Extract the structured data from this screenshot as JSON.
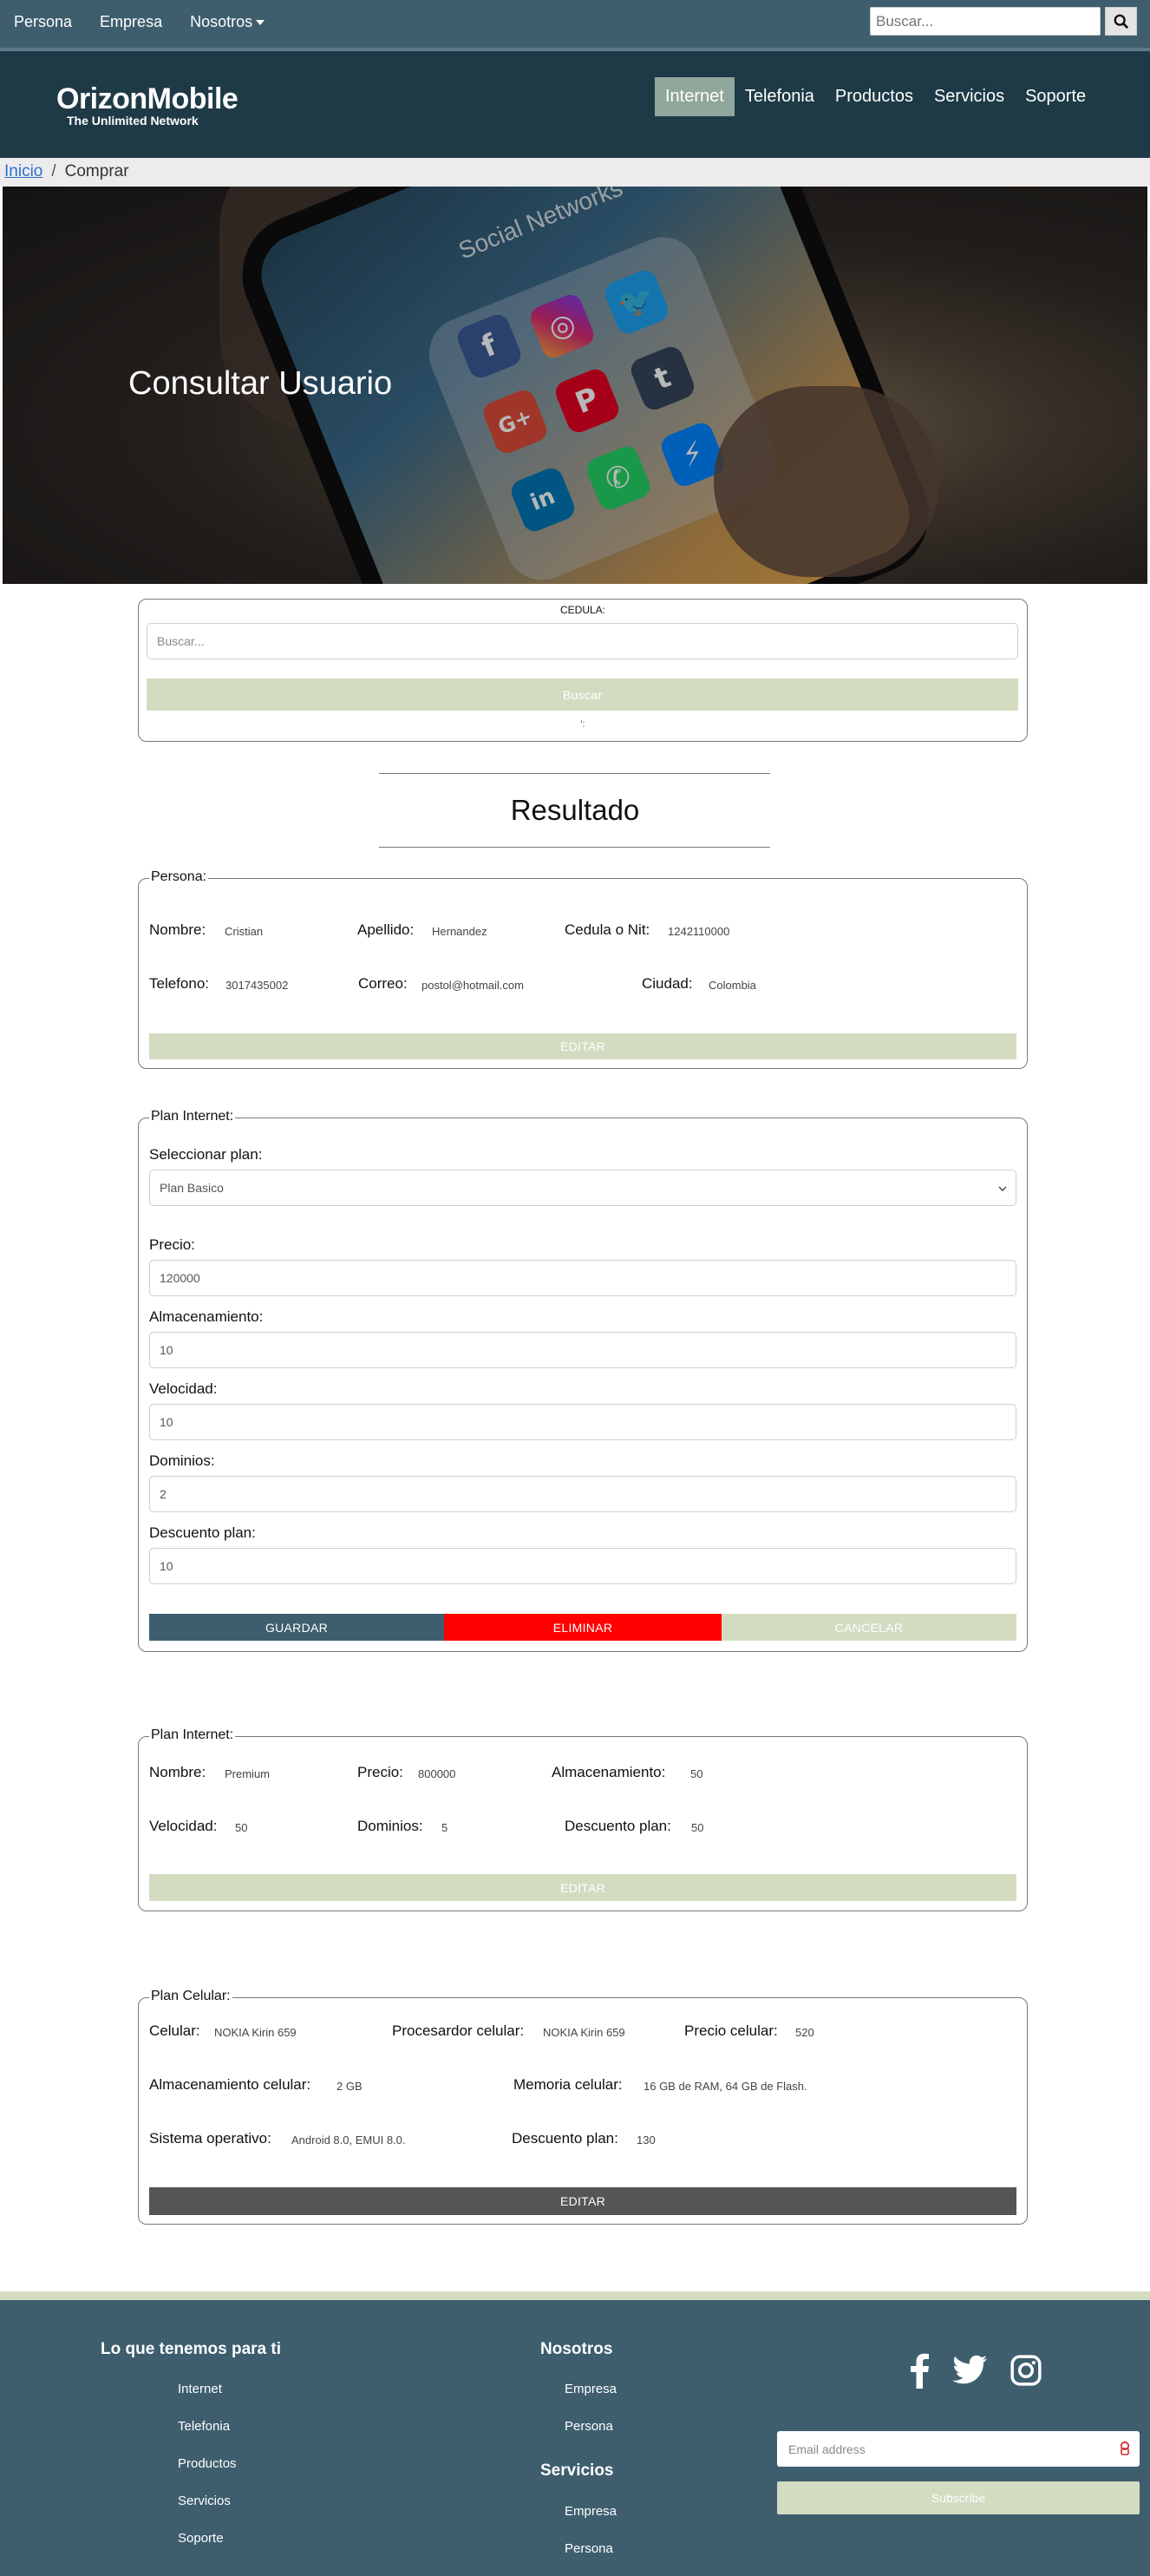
{
  "topbar": {
    "nav": [
      "Persona",
      "Empresa",
      "Nosotros"
    ],
    "search_placeholder": "Buscar..."
  },
  "header": {
    "brand": "OrizonMobile",
    "tagline": "The Unlimited Network",
    "nav": [
      "Internet",
      "Telefonia",
      "Productos",
      "Servicios",
      "Soporte"
    ],
    "active": "Internet"
  },
  "breadcrumb": {
    "home": "Inicio",
    "separator": "/",
    "current": "Comprar"
  },
  "hero": {
    "title": "Consultar Usuario",
    "image_text": "Social Networks"
  },
  "search_card": {
    "label": "CEDULA:",
    "placeholder": "Buscar...",
    "button": "Buscar",
    "note": "':"
  },
  "result": {
    "title": "Resultado"
  },
  "persona": {
    "legend": "Persona:",
    "fields": {
      "nombre": {
        "label": "Nombre:",
        "value": "Cristian"
      },
      "apellido": {
        "label": "Apellido:",
        "value": "Hernandez"
      },
      "cedula": {
        "label": "Cedula o Nit:",
        "value": "1242110000"
      },
      "telefono": {
        "label": "Telefono:",
        "value": "3017435002"
      },
      "correo": {
        "label": "Correo:",
        "value": "postol@hotmail.com"
      },
      "ciudad": {
        "label": "Ciudad:",
        "value": "Colombia"
      }
    },
    "edit_button": "EDITAR"
  },
  "plan_form": {
    "legend": "Plan Internet:",
    "select_label": "Seleccionar plan:",
    "select_value": "Plan Basico",
    "precio_label": "Precio:",
    "precio_value": "120000",
    "almacenamiento_label": "Almacenamiento:",
    "almacenamiento_value": "10",
    "velocidad_label": "Velocidad:",
    "velocidad_value": "10",
    "dominios_label": "Dominios:",
    "dominios_value": "2",
    "descuento_label": "Descuento plan:",
    "descuento_value": "10",
    "buttons": {
      "guardar": "GUARDAR",
      "eliminar": "ELIMINAR",
      "cancelar": "CANCELAR"
    }
  },
  "plan_internet": {
    "legend": "Plan Internet:",
    "fields": {
      "nombre": {
        "label": "Nombre:",
        "value": "Premium"
      },
      "precio": {
        "label": "Precio:",
        "value": "800000"
      },
      "almacenamiento": {
        "label": "Almacenamiento:",
        "value": "50"
      },
      "velocidad": {
        "label": "Velocidad:",
        "value": "50"
      },
      "dominios": {
        "label": "Dominios:",
        "value": "5"
      },
      "descuento": {
        "label": "Descuento plan:",
        "value": "50"
      }
    },
    "edit_button": "EDITAR"
  },
  "plan_celular": {
    "legend": "Plan Celular:",
    "fields": {
      "celular": {
        "label": "Celular:",
        "value": "NOKIA Kirin 659"
      },
      "procesador": {
        "label": "Procesardor celular:",
        "value": "NOKIA Kirin 659"
      },
      "precio": {
        "label": "Precio celular:",
        "value": "520"
      },
      "almacenamiento": {
        "label": "Almacenamiento celular:",
        "value": "2 GB"
      },
      "memoria": {
        "label": "Memoria celular:",
        "value": "16 GB de RAM, 64 GB de Flash."
      },
      "sistema": {
        "label": "Sistema operativo:",
        "value": "Android 8.0, EMUI 8.0."
      },
      "descuento": {
        "label": "Descuento plan:",
        "value": "130"
      }
    },
    "edit_button": "EDITAR"
  },
  "footer": {
    "col1": {
      "title": "Lo que tenemos para ti",
      "items": [
        "Internet",
        "Telefonia",
        "Productos",
        "Servicios",
        "Soporte"
      ]
    },
    "col2": {
      "title": "Nosotros",
      "items": [
        "Empresa",
        "Persona"
      ]
    },
    "col3": {
      "title": "Servicios",
      "items": [
        "Empresa",
        "Persona"
      ]
    },
    "social_icons": [
      "facebook-icon",
      "twitter-icon",
      "instagram-icon"
    ],
    "email_placeholder": "Email address",
    "subscribe": "Subscribe"
  },
  "colors": {
    "topbar": "#3e5e6e",
    "header": "#1e3a47",
    "accent_green": "#d3dcc1",
    "guardar": "#3e5e6e",
    "eliminar": "#ff0000",
    "celular_edit": "#555555"
  }
}
